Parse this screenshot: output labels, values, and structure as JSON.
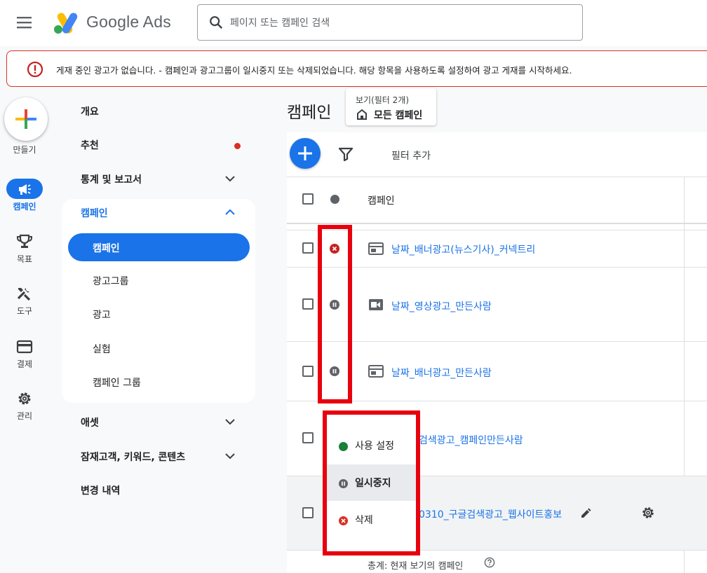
{
  "header": {
    "app_name": "Google Ads",
    "search_placeholder": "페이지 또는 캠페인 검색"
  },
  "alert": {
    "message": "게재 중인 광고가 없습니다. - 캠페인과 광고그룹이 일시중지 또는 삭제되었습니다. 해당 항목을 사용하도록 설정하여 광고 게재를 시작하세요."
  },
  "rail": {
    "create_label": "만들기",
    "items": [
      {
        "label": "캠페인",
        "icon": "megaphone-icon",
        "active": true
      },
      {
        "label": "목표",
        "icon": "trophy-icon"
      },
      {
        "label": "도구",
        "icon": "tools-icon"
      },
      {
        "label": "결제",
        "icon": "credit-card-icon"
      },
      {
        "label": "관리",
        "icon": "gear-icon"
      }
    ]
  },
  "nav": {
    "items": [
      {
        "label": "개요"
      },
      {
        "label": "추천"
      },
      {
        "label": "통계 및 보고서"
      },
      {
        "label": "캠페인"
      },
      {
        "label": "애셋"
      },
      {
        "label": "잠재고객, 키워드, 콘텐츠"
      },
      {
        "label": "변경 내역"
      }
    ],
    "campaign_sub": [
      {
        "label": "캠페인",
        "active": true
      },
      {
        "label": "광고그룹"
      },
      {
        "label": "광고"
      },
      {
        "label": "실험"
      },
      {
        "label": "캠페인 그룹"
      }
    ]
  },
  "main": {
    "title": "캠페인",
    "view_label": "보기(필터 2개)",
    "view_value": "모든 캠페인",
    "filter_add": "필터 추가",
    "col_campaign": "캠페인",
    "rows": [
      {
        "name": "날짜_배너광고(뉴스기사)_커넥트리",
        "status": "removed",
        "type": "display"
      },
      {
        "name": "날짜_영상광고_만든사람",
        "status": "paused",
        "type": "video"
      },
      {
        "name": "날짜_배너광고_만든사람",
        "status": "paused",
        "type": "display"
      },
      {
        "name": "검색광고_캠페인만든사람",
        "status": "",
        "type": ""
      },
      {
        "name": "0310_구글검색광고_웹사이트홍보",
        "status": "",
        "type": ""
      }
    ],
    "footer": "총계: 현재 보기의 캠페인"
  },
  "status_menu": {
    "items": [
      {
        "label": "사용 설정",
        "color": "#188038"
      },
      {
        "label": "일시중지",
        "color": "#5f6368"
      },
      {
        "label": "삭제",
        "color": "#d93025"
      }
    ]
  },
  "colors": {
    "accent": "#1a73e8",
    "highlight": "#e8000e",
    "error": "#d93025"
  }
}
